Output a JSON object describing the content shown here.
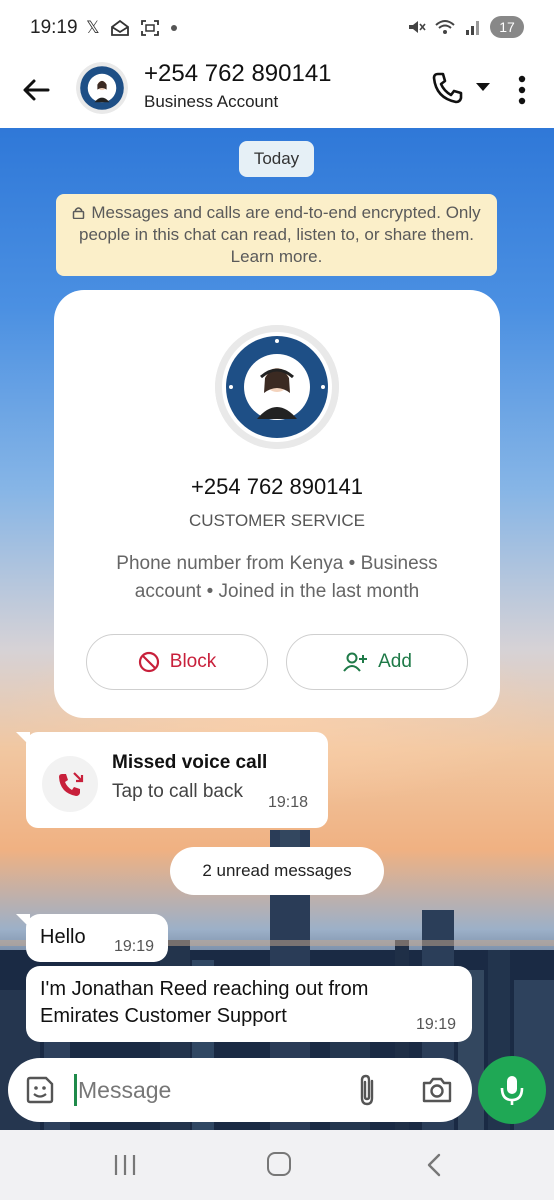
{
  "status_bar": {
    "time": "19:19",
    "left_icons": [
      "x-icon",
      "mail-icon",
      "screenshot-icon",
      "dot-icon"
    ],
    "right_icons": [
      "mute-icon",
      "wifi-icon",
      "signal-icon"
    ],
    "battery": "17"
  },
  "header": {
    "title": "+254 762 890141",
    "subtitle": "Business Account"
  },
  "chat": {
    "date_pill": "Today",
    "encryption_notice": "Messages and calls are end-to-end encrypted. Only people in this chat can read, listen to, or share them. Learn more.",
    "contact_card": {
      "phone": "+254 762 890141",
      "name": "CUSTOMER SERVICE",
      "description": "Phone number from Kenya • Business account • Joined in the last month",
      "block_label": "Block",
      "add_label": "Add"
    },
    "missed_call": {
      "title": "Missed voice call",
      "subtitle": "Tap to call back",
      "time": "19:18"
    },
    "unread_label": "2 unread messages",
    "messages": [
      {
        "text": "Hello",
        "time": "19:19"
      },
      {
        "text": "I'm Jonathan Reed reaching out from Emirates Customer Support",
        "time": "19:19"
      }
    ]
  },
  "composer": {
    "placeholder": "Message"
  },
  "colors": {
    "accent_green": "#1fa855",
    "block_red": "#c8203b",
    "add_green": "#1f7a48",
    "encryption_bg": "#fbefc9"
  }
}
